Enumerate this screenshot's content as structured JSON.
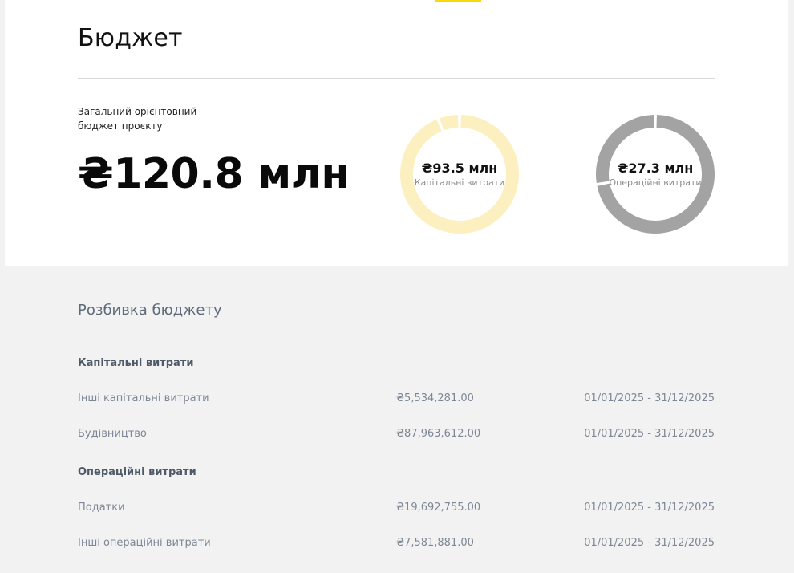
{
  "budget": {
    "title": "Бюджет",
    "total_label": "Загальний орієнтовний бюджет проєкту",
    "total_value": "₴120.8 млн"
  },
  "donuts": [
    {
      "value": "₴93.5 млн",
      "caption": "Капітальні витрати",
      "base_color": "#fdf0c0",
      "segments": [
        0.941,
        0.059
      ]
    },
    {
      "value": "₴27.3 млн",
      "caption": "Операційні витрати",
      "base_color": "#a3a3a3",
      "segments": [
        0.722,
        0.278
      ]
    }
  ],
  "breakdown": {
    "title": "Розбивка бюджету",
    "categories": [
      {
        "title": "Капітальні витрати",
        "rows": [
          {
            "name": "Інші капітальні витрати",
            "amount": "₴5,534,281.00",
            "period": "01/01/2025 - 31/12/2025"
          },
          {
            "name": "Будівництво",
            "amount": "₴87,963,612.00",
            "period": "01/01/2025 - 31/12/2025"
          }
        ]
      },
      {
        "title": "Операційні витрати",
        "rows": [
          {
            "name": "Податки",
            "amount": "₴19,692,755.00",
            "period": "01/01/2025 - 31/12/2025"
          },
          {
            "name": "Інші операційні витрати",
            "amount": "₴7,581,881.00",
            "period": "01/01/2025 - 31/12/2025"
          }
        ]
      }
    ]
  },
  "colors": {
    "accent": "#f5d90a",
    "card": "#ffffff",
    "background": "#f2f2f2"
  }
}
